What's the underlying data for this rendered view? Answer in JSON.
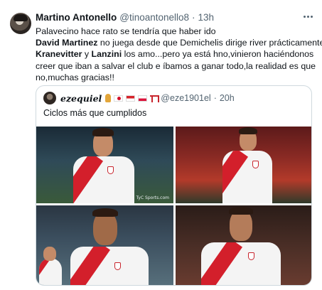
{
  "tweet": {
    "author_name": "Martino Antonello",
    "author_handle": "@tinoantonello8",
    "separator": "·",
    "time": "13h",
    "lines": {
      "line1": "Palavecino hace rato se tendría que haber ido",
      "line2_bold": "David Martinez",
      "line2_rest": " no juega desde que Demichelis dirige river prácticamente",
      "line3_bold1": "Kranevitter",
      "line3_mid": " y ",
      "line3_bold2": "Lanzini",
      "line3_rest": " los amo...pero ya está hno,vinieron haciéndonos",
      "line4": "creer que iban a salvar el club e íbamos a ganar todo,la realidad es que",
      "line5": "no,muchas gracias!!"
    }
  },
  "quote": {
    "author_name": "ezequiel",
    "author_handle": "@eze1901el",
    "separator": "·",
    "time": "20h",
    "emojis": [
      "wheat",
      "japan-flag",
      "indonesia-flag",
      "poland-flag",
      "torii-gate"
    ],
    "text": "Ciclos más que cumplidos",
    "photo_watermark": "TyC Sports.com"
  },
  "colors": {
    "text_primary": "#0f1419",
    "text_secondary": "#536471",
    "border": "#cfd9de",
    "river_red": "#d31f2b"
  }
}
